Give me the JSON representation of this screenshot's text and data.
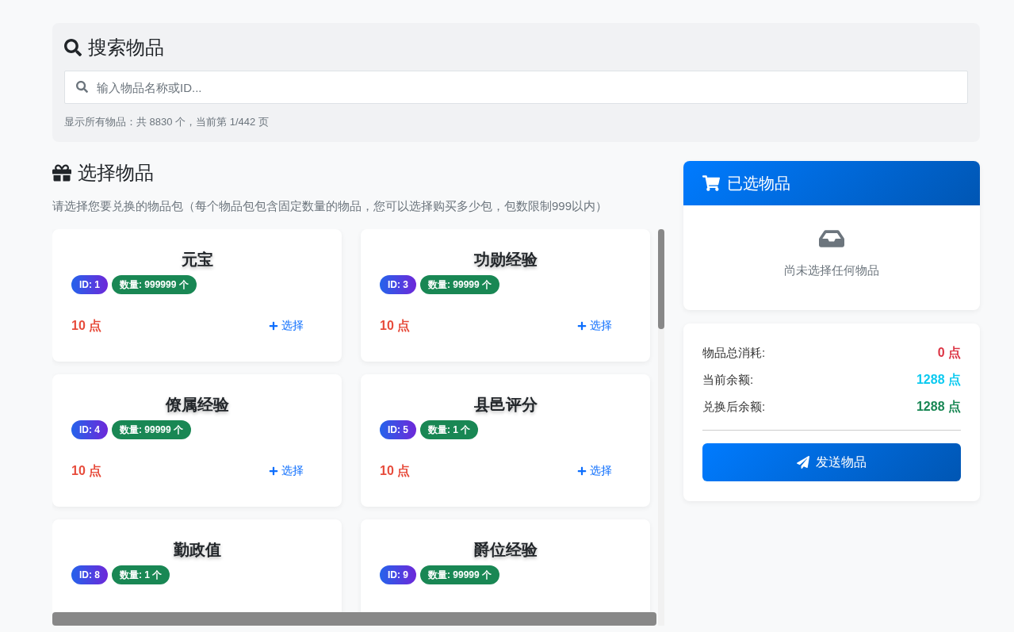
{
  "search": {
    "title": "搜索物品",
    "placeholder": "输入物品名称或ID...",
    "summary": "显示所有物品：共 8830 个，当前第 1/442 页"
  },
  "catalog": {
    "title": "选择物品",
    "description": "请选择您要兑换的物品包（每个物品包包含固定数量的物品，您可以选择购买多少包，包数限制999以内）",
    "items": [
      {
        "name": "元宝",
        "id_badge": "ID: 1",
        "quantity_badge": "数量: 999999 个",
        "price": "10 点",
        "select_label": "选择"
      },
      {
        "name": "功勋经验",
        "id_badge": "ID: 3",
        "quantity_badge": "数量: 99999 个",
        "price": "10 点",
        "select_label": "选择"
      },
      {
        "name": "僚属经验",
        "id_badge": "ID: 4",
        "quantity_badge": "数量: 99999 个",
        "price": "10 点",
        "select_label": "选择"
      },
      {
        "name": "县邑评分",
        "id_badge": "ID: 5",
        "quantity_badge": "数量: 1 个",
        "price": "10 点",
        "select_label": "选择"
      },
      {
        "name": "勤政值",
        "id_badge": "ID: 8",
        "quantity_badge": "数量: 1 个"
      },
      {
        "name": "爵位经验",
        "id_badge": "ID: 9",
        "quantity_badge": "数量: 99999 个"
      }
    ]
  },
  "selected": {
    "title": "已选物品",
    "empty_text": "尚未选择任何物品"
  },
  "summary": {
    "rows": [
      {
        "label": "物品总消耗:",
        "value": "0 点",
        "color": "#dc3545"
      },
      {
        "label": "当前余额:",
        "value": "1288 点",
        "color": "#0dcaf0"
      },
      {
        "label": "兑换后余额:",
        "value": "1288 点",
        "color": "#198754"
      }
    ],
    "button": "发送物品"
  }
}
